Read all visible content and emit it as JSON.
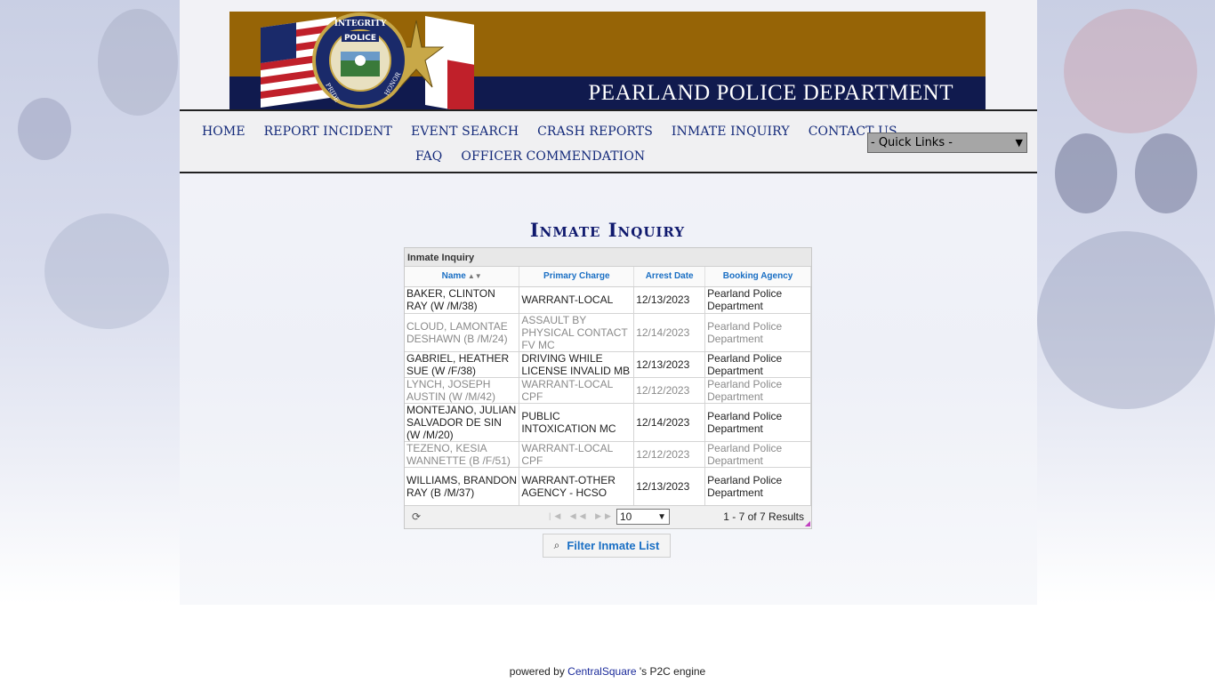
{
  "banner": {
    "title": "PEARLAND POLICE DEPARTMENT",
    "logo_text": [
      "INTEGRITY",
      "POLICE",
      "PRIDE",
      "HONOR"
    ]
  },
  "nav": {
    "row1": [
      "HOME",
      "REPORT INCIDENT",
      "EVENT SEARCH",
      "CRASH REPORTS",
      "INMATE INQUIRY",
      "CONTACT US"
    ],
    "row2": [
      "FAQ",
      "OFFICER COMMENDATION"
    ],
    "quick_links": "- Quick Links -"
  },
  "page_title": "Inmate Inquiry",
  "grid": {
    "caption": "Inmate Inquiry",
    "columns": [
      "Name",
      "Primary Charge",
      "Arrest Date",
      "Booking Agency"
    ],
    "rows": [
      [
        "BAKER, CLINTON RAY (W /M/38)",
        "WARRANT-LOCAL",
        "12/13/2023",
        "Pearland Police Department"
      ],
      [
        "CLOUD, LAMONTAE DESHAWN (B /M/24)",
        "ASSAULT BY PHYSICAL CONTACT FV MC",
        "12/14/2023",
        "Pearland Police Department"
      ],
      [
        "GABRIEL, HEATHER SUE (W /F/38)",
        "DRIVING WHILE LICENSE INVALID MB",
        "12/13/2023",
        "Pearland Police Department"
      ],
      [
        "LYNCH, JOSEPH AUSTIN (W /M/42)",
        "WARRANT-LOCAL CPF",
        "12/12/2023",
        "Pearland Police Department"
      ],
      [
        "MONTEJANO, JULIAN SALVADOR DE SIN (W /M/20)",
        "PUBLIC INTOXICATION MC",
        "12/14/2023",
        "Pearland Police Department"
      ],
      [
        "TEZENO, KESIA WANNETTE (B /F/51)",
        "WARRANT-LOCAL CPF",
        "12/12/2023",
        "Pearland Police Department"
      ],
      [
        "WILLIAMS, BRANDON RAY (B /M/37)",
        "WARRANT-OTHER AGENCY - HCSO",
        "12/13/2023",
        "Pearland Police Department"
      ]
    ],
    "page_size": "10",
    "results": "1 - 7 of 7 Results"
  },
  "filter_button": "Filter Inmate List",
  "footer": {
    "prefix": "powered by ",
    "link": "CentralSquare",
    "suffix": " 's P2C engine"
  }
}
